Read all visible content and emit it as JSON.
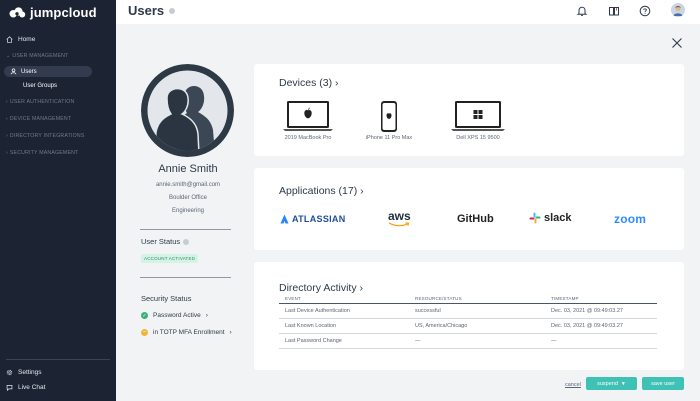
{
  "brand": {
    "name": "jumpcloud"
  },
  "sidebar": {
    "home": "Home",
    "sections": {
      "user_management": "USER MANAGEMENT",
      "user_authentication": "USER AUTHENTICATION",
      "device_management": "DEVICE MANAGEMENT",
      "directory_integrations": "DIRECTORY INTEGRATIONS",
      "security_management": "SECURITY MANAGEMENT"
    },
    "users": "Users",
    "user_groups": "User Groups",
    "settings": "Settings",
    "live_chat": "Live Chat"
  },
  "header": {
    "title": "Users"
  },
  "profile": {
    "name": "Annie Smith",
    "email": "annie.smith@gmail.com",
    "location": "Boulder Office",
    "department": "Engineering",
    "user_status_label": "User Status",
    "user_status_badge": "ACCOUNT ACTIVATED",
    "security_status_label": "Security Status",
    "password_status": "Password Active",
    "mfa_status": "in TOTP MFA Enrollment"
  },
  "devices": {
    "title": "Devices (3)",
    "items": [
      {
        "label": "2019 MacBook Pro",
        "icon": "apple-icon"
      },
      {
        "label": "iPhone 11 Pro Max",
        "icon": "apple-icon"
      },
      {
        "label": "Dell XPS 15 9500",
        "icon": "windows-icon"
      }
    ]
  },
  "applications": {
    "title": "Applications (17)",
    "items": [
      "ATLASSIAN",
      "aws",
      "GitHub",
      "slack",
      "zoom"
    ]
  },
  "activity": {
    "title": "Directory Activity",
    "columns": [
      "EVENT",
      "RESOURCE/STATUS",
      "TIMESTAMP"
    ],
    "rows": [
      [
        "Last Device Authentication",
        "successful",
        "Dec. 03, 2021 @ 09:49:03.27"
      ],
      [
        "Last Known Location",
        "US, America/Chicago",
        "Dec. 03, 2021 @ 09:49:03.27"
      ],
      [
        "Last Password Change",
        "—",
        "—"
      ]
    ]
  },
  "actions": {
    "cancel": "cancel",
    "suspend": "suspend",
    "save": "save user"
  },
  "colors": {
    "sidebar_bg": "#1c2434",
    "accent": "#3fc2b5",
    "success": "#3ab07a",
    "warning": "#f1b43b"
  }
}
